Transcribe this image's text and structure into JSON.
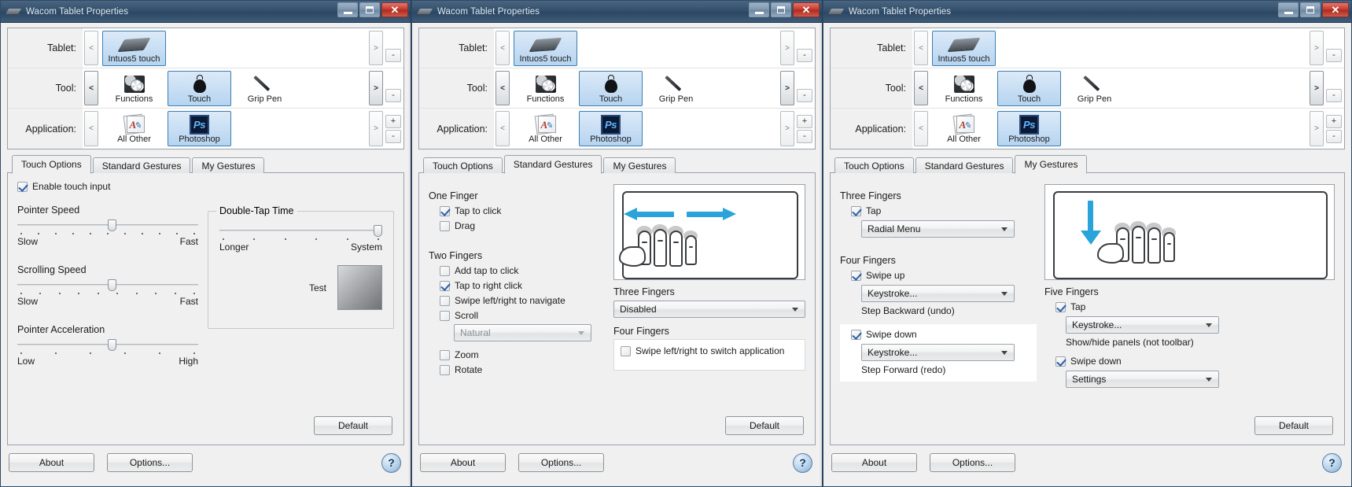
{
  "window_title": "Wacom Tablet Properties",
  "window_controls": {
    "minimize": "minimize-button",
    "maximize": "maximize-button",
    "close": "✕"
  },
  "selector": {
    "rows": [
      {
        "label": "Tablet:",
        "prev": "<",
        "next": ">",
        "items": [
          {
            "caption": "Intuos5 touch",
            "icon": "tablet-icon",
            "selected": true
          }
        ]
      },
      {
        "label": "Tool:",
        "prev": "<",
        "next": ">",
        "items": [
          {
            "caption": "Functions",
            "icon": "functions-icon",
            "selected": false
          },
          {
            "caption": "Touch",
            "icon": "touch-icon",
            "selected": true
          },
          {
            "caption": "Grip Pen",
            "icon": "grip-pen-icon",
            "selected": false
          }
        ]
      },
      {
        "label": "Application:",
        "prev": "<",
        "next": ">",
        "plus": "+",
        "minus": "-",
        "items": [
          {
            "caption": "All Other",
            "icon": "all-other-icon",
            "selected": false
          },
          {
            "caption": "Photoshop",
            "icon": "photoshop-icon",
            "selected": true
          }
        ]
      }
    ]
  },
  "tabs": [
    {
      "label": "Touch Options"
    },
    {
      "label": "Standard Gestures"
    },
    {
      "label": "My Gestures"
    }
  ],
  "bottom": {
    "about": "About",
    "options": "Options...",
    "help": "?",
    "default": "Default"
  },
  "win1": {
    "active_tab": "Touch Options",
    "enable_touch": {
      "label": "Enable touch input",
      "checked": true
    },
    "sliders": [
      {
        "title": "Pointer Speed",
        "left": "Slow",
        "right": "Fast",
        "value_pct": 52,
        "ticks": 11
      },
      {
        "title": "Scrolling Speed",
        "left": "Slow",
        "right": "Fast",
        "value_pct": 52,
        "ticks": 10
      },
      {
        "title": "Pointer Acceleration",
        "left": "Low",
        "right": "High",
        "value_pct": 52,
        "ticks": 6
      }
    ],
    "double_tap": {
      "title": "Double-Tap Time",
      "left": "Longer",
      "right": "System",
      "value_pct": 100,
      "ticks": 6,
      "test_label": "Test"
    }
  },
  "win2": {
    "active_tab": "Standard Gestures",
    "groups": [
      {
        "title": "One Finger",
        "items": [
          {
            "label": "Tap to click",
            "checked": true
          },
          {
            "label": "Drag",
            "checked": false
          }
        ]
      },
      {
        "title": "Two Fingers",
        "items": [
          {
            "label": "Add tap to click",
            "checked": false
          },
          {
            "label": "Tap to right click",
            "checked": true
          },
          {
            "label": "Swipe left/right to navigate",
            "checked": false
          },
          {
            "label": "Scroll",
            "checked": false,
            "combo": "Natural",
            "combo_disabled": true
          },
          {
            "label": "Zoom",
            "checked": false
          },
          {
            "label": "Rotate",
            "checked": false
          }
        ]
      }
    ],
    "three_fingers": {
      "title": "Three Fingers",
      "combo": "Disabled"
    },
    "four_fingers": {
      "title": "Four Fingers",
      "items": [
        {
          "label": "Swipe left/right to switch application",
          "checked": false
        }
      ]
    },
    "illustration": "two-finger-swipe-left-right-illustration"
  },
  "win3": {
    "active_tab": "My Gestures",
    "three_fingers": {
      "title": "Three Fingers",
      "items": [
        {
          "label": "Tap",
          "checked": true,
          "combo": "Radial Menu"
        }
      ]
    },
    "four_fingers": {
      "title": "Four Fingers",
      "items": [
        {
          "label": "Swipe up",
          "checked": true,
          "combo": "Keystroke...",
          "desc": "Step Backward (undo)"
        },
        {
          "label": "Swipe down",
          "checked": true,
          "combo": "Keystroke...",
          "desc": "Step Forward (redo)",
          "highlight": true
        }
      ]
    },
    "five_fingers": {
      "title": "Five Fingers",
      "items": [
        {
          "label": "Tap",
          "checked": true,
          "combo": "Keystroke...",
          "desc": "Show/hide panels (not toolbar)"
        },
        {
          "label": "Swipe down",
          "checked": true,
          "combo": "Settings",
          "desc": ""
        }
      ]
    },
    "illustration": "four-finger-swipe-down-illustration"
  },
  "colors": {
    "titlebar_start": "#4a6580",
    "titlebar_end": "#2c4763",
    "selection_blue": "#3c7fb1",
    "selection_fill": "#b6d4f0",
    "arrow_cyan": "#29a3d9",
    "panel_bg": "#f0f0f0",
    "close_red": "#c4392c"
  }
}
